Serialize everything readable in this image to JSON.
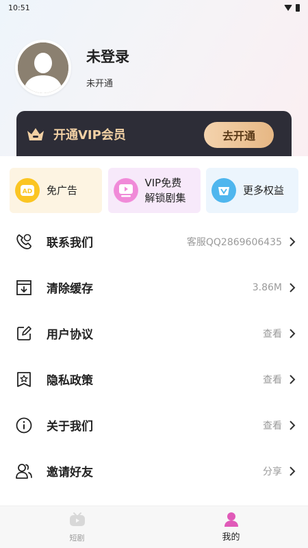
{
  "status_bar": {
    "time": "10:51"
  },
  "profile": {
    "username": "未登录",
    "status": "未开通"
  },
  "vip": {
    "title": "开通VIP会员",
    "button": "去开通",
    "accent": "#f1d0a4"
  },
  "benefits": [
    {
      "label": "免广告",
      "icon": "ad-icon",
      "badge": "AD"
    },
    {
      "label_line1": "VIP免费",
      "label_line2": "解锁剧集",
      "icon": "tv-play-icon"
    },
    {
      "label": "更多权益",
      "icon": "v-gift-icon",
      "badge": "V"
    }
  ],
  "menu": [
    {
      "label": "联系我们",
      "value": "客服QQ2869606435",
      "icon": "contact-icon"
    },
    {
      "label": "清除缓存",
      "value": "3.86M",
      "icon": "clear-cache-icon"
    },
    {
      "label": "用户协议",
      "value": "查看",
      "icon": "edit-doc-icon"
    },
    {
      "label": "隐私政策",
      "value": "查看",
      "icon": "privacy-badge-icon"
    },
    {
      "label": "关于我们",
      "value": "查看",
      "icon": "info-icon"
    },
    {
      "label": "邀请好友",
      "value": "分享",
      "icon": "users-icon"
    }
  ],
  "tabbar": [
    {
      "label": "短剧",
      "icon": "tv-icon",
      "active": false
    },
    {
      "label": "我的",
      "icon": "user-icon",
      "active": true,
      "color": "#e05ab8"
    }
  ]
}
